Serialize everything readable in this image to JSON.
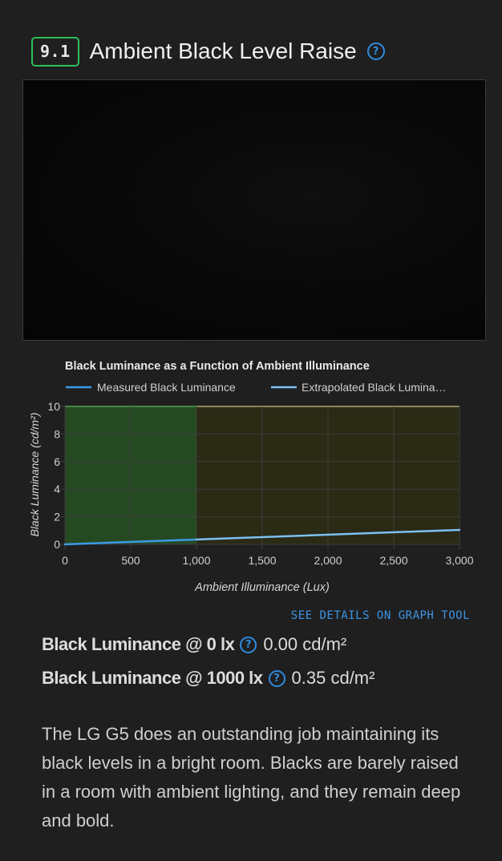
{
  "header": {
    "score": "9.1",
    "title": "Ambient Black Level Raise",
    "help_symbol": "?"
  },
  "chart_data": {
    "type": "line",
    "title": "Black Luminance as a Function of Ambient Illuminance",
    "xlabel": "Ambient Illuminance (Lux)",
    "ylabel": "Black Luminance (cd/m²)",
    "xlim": [
      0,
      3000
    ],
    "ylim": [
      0,
      10
    ],
    "x_ticks": [
      "0",
      "500",
      "1,000",
      "1,500",
      "2,000",
      "2,500",
      "3,000"
    ],
    "y_ticks": [
      "0",
      "2",
      "4",
      "6",
      "8",
      "10"
    ],
    "legend_position": "top",
    "regions": [
      {
        "from": 0,
        "to": 1000,
        "color": "#254a22",
        "edge_color": "#4fd04f"
      },
      {
        "from": 1000,
        "to": 3000,
        "color": "#2a2a15",
        "edge_color": "#d8d27a"
      }
    ],
    "series": [
      {
        "name": "Measured Black Luminance",
        "color": "#3c9be6",
        "x": [
          0,
          1000
        ],
        "y": [
          0.0,
          0.35
        ]
      },
      {
        "name": "Extrapolated Black Lumina…",
        "color": "#7cc0f2",
        "x": [
          1000,
          3000
        ],
        "y": [
          0.35,
          1.05
        ]
      }
    ]
  },
  "graph_link": "SEE DETAILS ON GRAPH TOOL",
  "tests": [
    {
      "label": "Black Luminance @ 0 lx",
      "value": "0.00 cd/m²"
    },
    {
      "label": "Black Luminance @ 1000 lx",
      "value": "0.35 cd/m²"
    }
  ],
  "description": "The LG G5 does an outstanding job maintaining its black levels in a bright room. Blacks are barely raised in a room with ambient lighting, and they remain deep and bold."
}
